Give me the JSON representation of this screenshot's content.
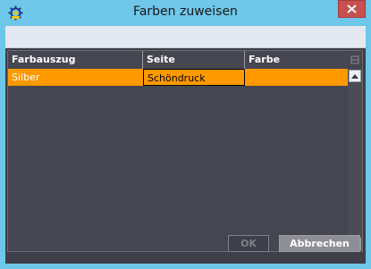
{
  "window": {
    "title": "Farben zuweisen",
    "accent": "#6ec6e9",
    "icons": {
      "app": "gear-icon",
      "close": "close-icon"
    }
  },
  "table": {
    "columns": [
      "Farbauszug",
      "Seite",
      "Farbe"
    ],
    "rows": [
      {
        "farbauszug": "Silber",
        "seite": "Schöndruck",
        "farbe": ""
      }
    ],
    "selected_row_color": "#ff9900"
  },
  "buttons": {
    "ok_label": "OK",
    "cancel_label": "Abbrechen"
  }
}
